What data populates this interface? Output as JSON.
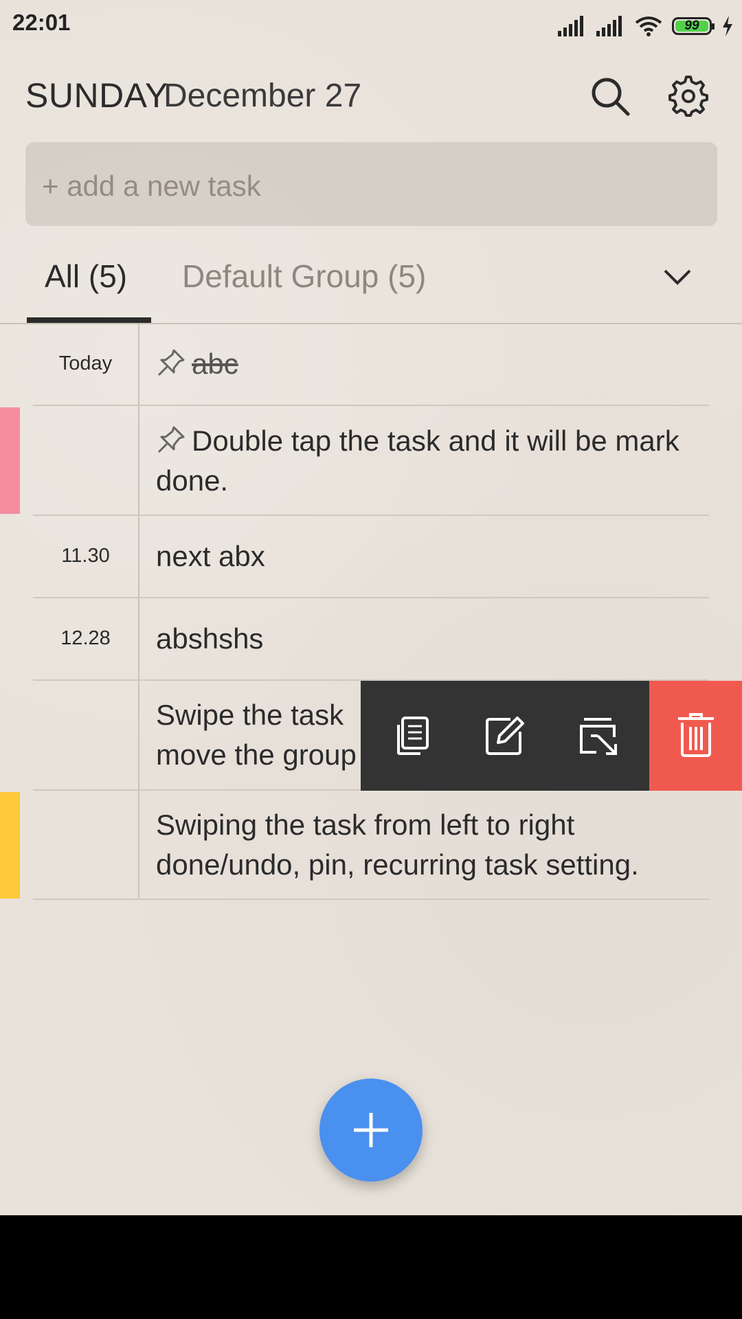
{
  "status_bar": {
    "time": "22:01",
    "battery": "99"
  },
  "header": {
    "day": "SUNDAY",
    "date": "December 27",
    "search_icon": "search-icon",
    "settings_icon": "gear-icon"
  },
  "add_task": {
    "placeholder": "+ add a new task"
  },
  "tabs": [
    {
      "label": "All (5)",
      "active": true
    },
    {
      "label": "Default Group (5)",
      "active": false
    }
  ],
  "tasks": [
    {
      "date": "Today",
      "text": "abc",
      "pinned": true,
      "done": true,
      "color": ""
    },
    {
      "date": "",
      "text": "Double tap the task and it will be mark done.",
      "pinned": true,
      "done": false,
      "color": "#f48ca0"
    },
    {
      "date": "11.30",
      "text": "next abx",
      "pinned": false,
      "done": false,
      "color": ""
    },
    {
      "date": "12.28",
      "text": "abshshs",
      "pinned": false,
      "done": false,
      "color": ""
    },
    {
      "date": "",
      "text_line1": "Swipe the task",
      "text_line2": "move the group",
      "pinned": false,
      "done": false,
      "color": ""
    },
    {
      "date": "",
      "text": "Swiping the task from left to right done/undo, pin, recurring task setting.",
      "pinned": false,
      "done": false,
      "color": "#ffc93a"
    }
  ],
  "swipe_actions": [
    "copy-icon",
    "edit-icon",
    "move-group-icon",
    "trash-icon"
  ],
  "colors": {
    "accent": "#4a90ef",
    "delete": "#f05a4e",
    "action_bar": "#333333",
    "pink_tag": "#f48ca0",
    "yellow_tag": "#ffc93a"
  }
}
